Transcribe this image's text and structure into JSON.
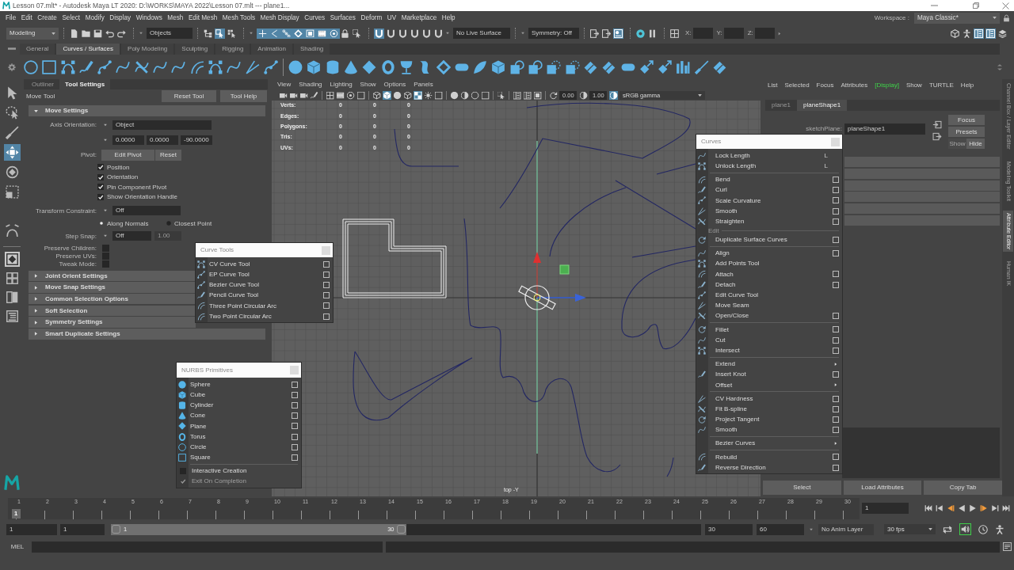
{
  "window": {
    "title": "Lesson 07.mlt* - Autodesk Maya LT 2020: D:\\WORKS\\MAYA 2022\\Lesson 07.mlt --- plane1..."
  },
  "menu_bar": [
    "File",
    "Edit",
    "Create",
    "Select",
    "Modify",
    "Display",
    "Windows",
    "Mesh",
    "Edit Mesh",
    "Mesh Tools",
    "Mesh Display",
    "Curves",
    "Surfaces",
    "Deform",
    "UV",
    "Marketplace",
    "Help"
  ],
  "workspace": {
    "label": "Workspace :",
    "value": "Maya Classic*"
  },
  "status_line": {
    "menu_set": "Modeling",
    "selection_mode": "Objects",
    "select_modes": [
      {
        "selected": false
      },
      {
        "selected": true
      },
      {
        "selected": false
      }
    ],
    "pick_masks": [
      {
        "on": true
      },
      {
        "on": true
      },
      {
        "on": true
      },
      {
        "on": true
      },
      {
        "on": true
      },
      {
        "on": true
      },
      {
        "on": true
      }
    ],
    "snaps": [
      {
        "on": true
      },
      {
        "on": false
      },
      {
        "on": false
      },
      {
        "on": false
      },
      {
        "on": false
      },
      {
        "on": false
      }
    ],
    "live_surface": "No Live Surface",
    "symmetry": "Symmetry: Off",
    "render_tools": [
      {
        "on": false
      },
      {
        "on": false
      },
      {
        "on": true
      }
    ],
    "coordinates": [
      "X:",
      "Y:",
      "Z:"
    ],
    "panel_toggles": [
      {
        "on": false
      },
      {
        "on": false
      },
      {
        "on": true
      },
      {
        "on": true
      },
      {
        "on": false
      }
    ]
  },
  "shelf": {
    "tabs": [
      {
        "label": "General",
        "selected": false
      },
      {
        "label": "Curves / Surfaces",
        "selected": true
      },
      {
        "label": "Poly Modeling",
        "selected": false
      },
      {
        "label": "Sculpting",
        "selected": false
      },
      {
        "label": "Rigging",
        "selected": false
      },
      {
        "label": "Animation",
        "selected": false
      },
      {
        "label": "Shading",
        "selected": false
      }
    ]
  },
  "toolbox": {
    "transform_tools": [
      {
        "kind": "select",
        "selected": false
      },
      {
        "kind": "lasso",
        "selected": false
      },
      {
        "kind": "paint",
        "selected": false
      },
      {
        "kind": "move",
        "selected": true
      },
      {
        "kind": "rotate",
        "selected": false
      },
      {
        "kind": "scale",
        "selected": false
      }
    ],
    "other_tools": [
      {
        "kind": "curve_handles",
        "selected": false
      }
    ],
    "layouts": [
      {
        "kind": "single",
        "selected": true
      },
      {
        "kind": "four",
        "selected": false
      },
      {
        "kind": "two",
        "selected": false
      },
      {
        "kind": "outliner",
        "selected": false
      }
    ]
  },
  "tool_settings": {
    "tabs": [
      {
        "label": "Outliner",
        "selected": false
      },
      {
        "label": "Tool Settings",
        "selected": true
      }
    ],
    "tool_name": "Move Tool",
    "buttons": [
      "Reset Tool",
      "Tool Help"
    ],
    "move_settings": {
      "title": "Move Settings",
      "expanded": true,
      "axis_orientation": {
        "label": "Axis Orientation:",
        "value": "Object"
      },
      "axis_values": [
        "0.0000",
        "0.0000",
        "-90.0000"
      ],
      "pivot": {
        "label": "Pivot:",
        "buttons": [
          "Edit Pivot",
          "Reset"
        ]
      },
      "options": [
        {
          "label": "Position",
          "checked": true
        },
        {
          "label": "Orientation",
          "checked": true
        },
        {
          "label": "Pin Component Pivot",
          "checked": true
        },
        {
          "label": "Show Orientation Handle",
          "checked": true
        }
      ],
      "transform_constraint": {
        "label": "Transform Constraint:",
        "value": "Off"
      },
      "constraint_modes": [
        {
          "label": "Along Normals",
          "selected": true
        },
        {
          "label": "Closest Point",
          "selected": false
        }
      ],
      "step_snap": {
        "label": "Step Snap:",
        "value": "Off",
        "amount": "1.00",
        "amount_disabled": true
      },
      "flags": [
        {
          "label": "Preserve Children:",
          "checked": false
        },
        {
          "label": "Preserve UVs:",
          "checked": false
        },
        {
          "label": "Tweak Mode:",
          "checked": false
        }
      ]
    },
    "sections": [
      {
        "title": "Joint Orient Settings",
        "expanded": false
      },
      {
        "title": "Move Snap Settings",
        "expanded": false
      },
      {
        "title": "Common Selection Options",
        "expanded": false
      },
      {
        "title": "Soft Selection",
        "expanded": false
      },
      {
        "title": "Symmetry Settings",
        "expanded": false
      },
      {
        "title": "Smart Duplicate Settings",
        "expanded": false
      }
    ]
  },
  "viewport": {
    "menu": [
      "View",
      "Shading",
      "Lighting",
      "Show",
      "Options",
      "Panels"
    ],
    "toolbar_toggles": [
      {
        "on": false
      },
      {
        "on": false
      },
      {
        "on": false
      },
      {
        "on": false
      },
      {
        "on": false
      },
      {
        "on": false
      },
      {
        "on": false
      },
      {
        "on": false
      },
      {
        "on": false
      },
      {
        "on": true
      },
      {
        "on": false
      },
      {
        "on": false
      },
      {
        "on": true
      },
      {
        "on": false
      },
      {
        "on": false
      },
      {
        "on": false
      },
      {
        "on": false
      },
      {
        "on": false
      },
      {
        "on": false
      },
      {
        "on": false
      },
      {
        "on": false
      },
      {
        "on": false
      },
      {
        "on": false
      },
      {
        "on": false
      },
      {
        "on": false
      },
      {
        "on": true
      }
    ],
    "exposure": "0.00",
    "gamma": "1.00",
    "color_space": "sRGB gamma",
    "hud": [
      {
        "label": "Verts:",
        "values": [
          "0",
          "0",
          "0"
        ]
      },
      {
        "label": "Edges:",
        "values": [
          "0",
          "0",
          "0"
        ]
      },
      {
        "label": "Polygons:",
        "values": [
          "0",
          "0",
          "0"
        ]
      },
      {
        "label": "Tris:",
        "values": [
          "0",
          "0",
          "0"
        ]
      },
      {
        "label": "UVs:",
        "values": [
          "0",
          "0",
          "0"
        ]
      }
    ],
    "camera": "top -Y"
  },
  "curve_tools": {
    "title": "Curve Tools",
    "items": [
      "CV Curve Tool",
      "EP Curve Tool",
      "Bezier Curve Tool",
      "Pencil Curve Tool",
      "Three Point Circular Arc",
      "Two Point Circular Arc"
    ]
  },
  "nurbs_primitives": {
    "title": "NURBS Primitives",
    "items": [
      "Sphere",
      "Cube",
      "Cylinder",
      "Cone",
      "Plane",
      "Torus",
      "Circle",
      "Square"
    ],
    "options": [
      {
        "label": "Interactive Creation",
        "checked": false,
        "disabled": false
      },
      {
        "label": "Exit On Completion",
        "checked": true,
        "disabled": true
      }
    ]
  },
  "curves_menu": {
    "title": "Curves",
    "groups": [
      {
        "items": [
          {
            "kind": "shortcut",
            "label": "Lock Length",
            "icon": true,
            "shortcut": "L"
          },
          {
            "kind": "shortcut",
            "label": "Unlock Length",
            "icon": true,
            "shortcut": "L"
          }
        ]
      },
      {
        "items": [
          {
            "kind": "option",
            "label": "Bend",
            "icon": true
          },
          {
            "kind": "option",
            "label": "Curl",
            "icon": true
          },
          {
            "kind": "option",
            "label": "Scale Curvature",
            "icon": true
          },
          {
            "kind": "option",
            "label": "Smooth",
            "icon": true
          },
          {
            "kind": "option",
            "label": "Straighten",
            "icon": true
          }
        ]
      },
      {
        "label": "Edit",
        "items": [
          {
            "kind": "option",
            "label": "Duplicate Surface Curves",
            "icon": true
          }
        ]
      },
      {
        "items": [
          {
            "kind": "option",
            "label": "Align",
            "icon": true
          },
          {
            "kind": "plain",
            "label": "Add Points Tool",
            "icon": true
          },
          {
            "kind": "option",
            "label": "Attach",
            "icon": true
          },
          {
            "kind": "option",
            "label": "Detach",
            "icon": true
          },
          {
            "kind": "plain",
            "label": "Edit Curve Tool",
            "icon": true
          },
          {
            "kind": "plain",
            "label": "Move Seam",
            "icon": true
          },
          {
            "kind": "option",
            "label": "Open/Close",
            "icon": true
          }
        ]
      },
      {
        "items": [
          {
            "kind": "option",
            "label": "Fillet",
            "icon": true
          },
          {
            "kind": "option",
            "label": "Cut",
            "icon": true
          },
          {
            "kind": "option",
            "label": "Intersect",
            "icon": true
          }
        ]
      },
      {
        "items": [
          {
            "kind": "submenu",
            "label": "Extend",
            "icon": false
          },
          {
            "kind": "option",
            "label": "Insert Knot",
            "icon": true
          },
          {
            "kind": "submenu",
            "label": "Offset",
            "icon": false
          }
        ]
      },
      {
        "items": [
          {
            "kind": "option",
            "label": "CV Hardness",
            "icon": true
          },
          {
            "kind": "option",
            "label": "Fit B-spline",
            "icon": true
          },
          {
            "kind": "option",
            "label": "Project Tangent",
            "icon": true
          },
          {
            "kind": "option",
            "label": "Smooth",
            "icon": true
          }
        ]
      },
      {
        "items": [
          {
            "kind": "submenu",
            "label": "Bezier Curves",
            "icon": false
          }
        ]
      },
      {
        "items": [
          {
            "kind": "option",
            "label": "Rebuild",
            "icon": true
          },
          {
            "kind": "option",
            "label": "Reverse Direction",
            "icon": true
          }
        ]
      }
    ]
  },
  "attribute_editor": {
    "menu": [
      {
        "label": "List",
        "highlighted": false
      },
      {
        "label": "Selected",
        "highlighted": false
      },
      {
        "label": "Focus",
        "highlighted": false
      },
      {
        "label": "Attributes",
        "highlighted": false
      },
      {
        "label": "[Display]",
        "highlighted": true
      },
      {
        "label": "Show",
        "highlighted": false
      },
      {
        "label": "TURTLE",
        "highlighted": false
      },
      {
        "label": "Help",
        "highlighted": false
      }
    ],
    "tabs": [
      {
        "label": "plane1",
        "selected": false
      },
      {
        "label": "planeShape1",
        "selected": true
      }
    ],
    "field": {
      "label": "sketchPlane:",
      "value": "planeShape1"
    },
    "buttons": [
      {
        "label": "Focus",
        "disabled": false
      },
      {
        "label": "Presets",
        "disabled": false
      },
      {
        "label": "Show",
        "disabled": true
      },
      {
        "label": "Hide",
        "disabled": false
      }
    ],
    "footer_buttons": [
      "Select",
      "Load Attributes",
      "Copy Tab"
    ]
  },
  "side_tabs": [
    {
      "label": "Channel Box / Layer Editor",
      "selected": false
    },
    {
      "label": "Modeling Toolkit",
      "selected": false
    },
    {
      "label": "Attribute Editor",
      "selected": true
    },
    {
      "label": "Human IK",
      "selected": false
    }
  ],
  "time_slider": {
    "frames": [
      "1",
      "2",
      "3",
      "4",
      "5",
      "6",
      "7",
      "8",
      "9",
      "10",
      "11",
      "12",
      "13",
      "14",
      "15",
      "16",
      "17",
      "18",
      "19",
      "20",
      "21",
      "22",
      "23",
      "24",
      "25",
      "26",
      "27",
      "28",
      "29",
      "30"
    ],
    "playhead": "1",
    "level": 0,
    "current_frame": "1"
  },
  "range_slider": {
    "start": "1",
    "range_start": "1",
    "level": 0.5,
    "bar_start": "1",
    "bar_end": "30",
    "range_end": "30",
    "end": "60",
    "anim_layer": "No Anim Layer",
    "fps": "30 fps",
    "sound_on": true
  },
  "command_line": {
    "language": "MEL"
  }
}
